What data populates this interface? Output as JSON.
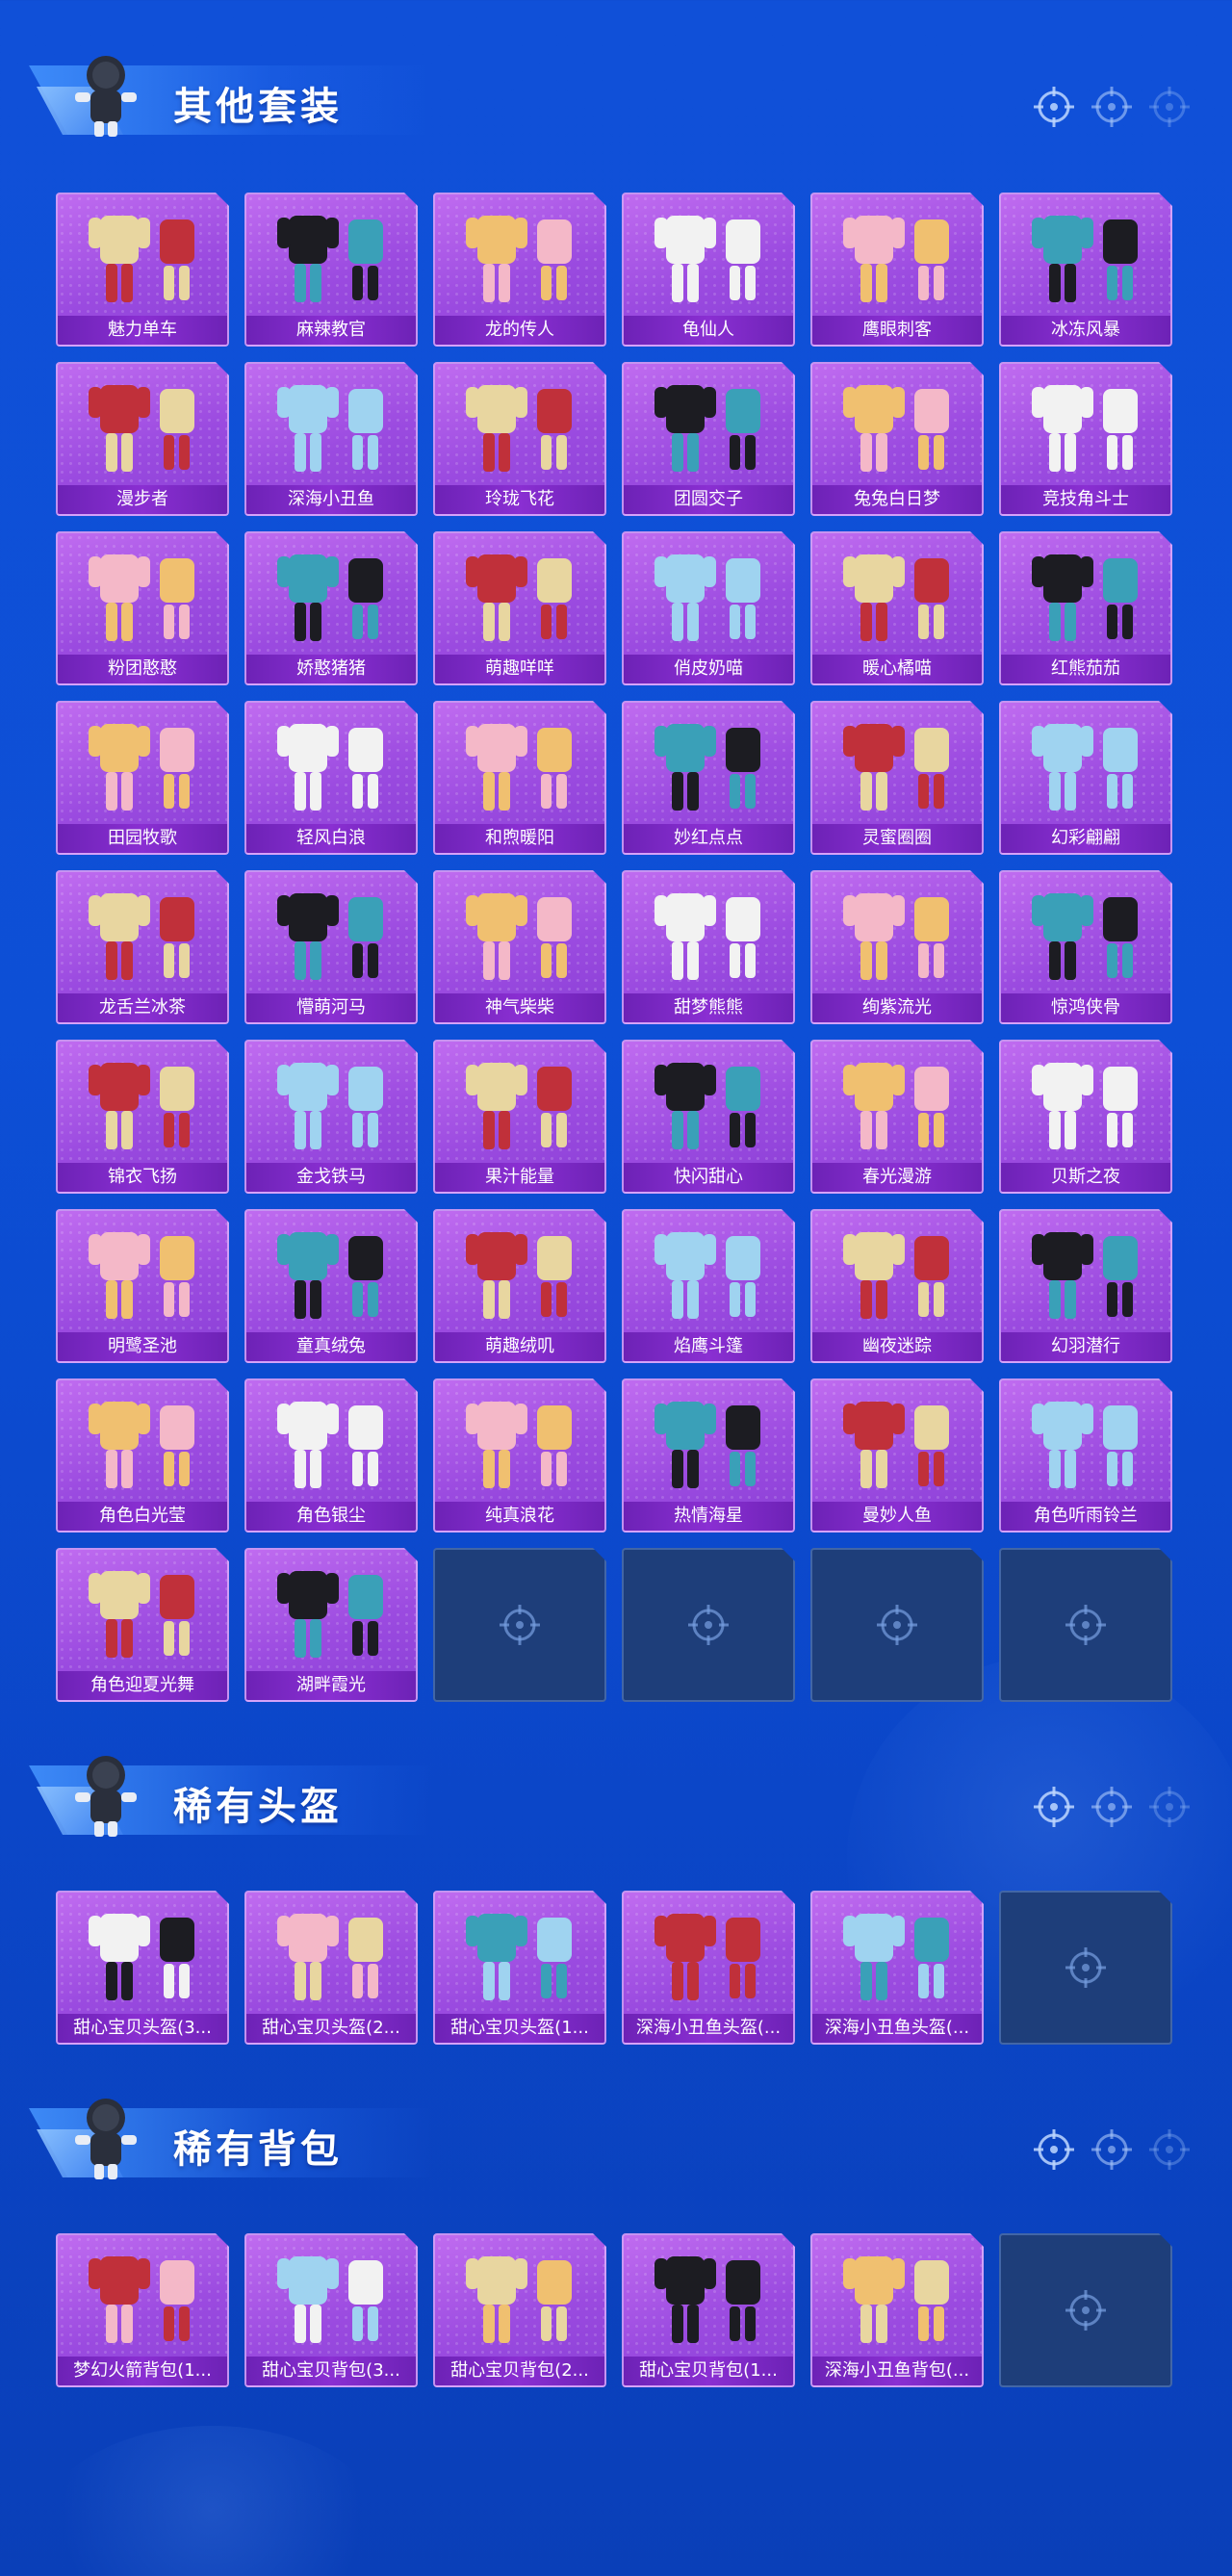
{
  "colors": {
    "page_bg": "#0d4fd6",
    "card_bg": "#a957e6",
    "card_label_bg": "#7a2bc4",
    "empty_card_bg": "#1e3e7a"
  },
  "sections": [
    {
      "title": "其他套装",
      "items": [
        "魅力单车",
        "麻辣教官",
        "龙的传人",
        "龟仙人",
        "鹰眼刺客",
        "冰冻风暴",
        "漫步者",
        "深海小丑鱼",
        "玲珑飞花",
        "团圆交子",
        "兔兔白日梦",
        "竞技角斗士",
        "粉团憨憨",
        "娇憨猪猪",
        "萌趣咩咩",
        "俏皮奶喵",
        "暖心橘喵",
        "红熊茄茄",
        "田园牧歌",
        "轻风白浪",
        "和煦暖阳",
        "妙红点点",
        "灵蜜圈圈",
        "幻彩翩翩",
        "龙舌兰冰茶",
        "懵萌河马",
        "神气柴柴",
        "甜梦熊熊",
        "绚紫流光",
        "惊鸿侠骨",
        "锦衣飞扬",
        "金戈铁马",
        "果汁能量",
        "快闪甜心",
        "春光漫游",
        "贝斯之夜",
        "明鹭圣池",
        "童真绒兔",
        "萌趣绒叽",
        "焰鹰斗篷",
        "幽夜迷踪",
        "幻羽潜行",
        "角色白光莹",
        "角色银尘",
        "纯真浪花",
        "热情海星",
        "曼妙人鱼",
        "角色听雨铃兰",
        "角色迎夏光舞",
        "湖畔霞光"
      ],
      "empty_slots": 4
    },
    {
      "title": "稀有头盔",
      "items": [
        "甜心宝贝头盔(3...",
        "甜心宝贝头盔(2...",
        "甜心宝贝头盔(1...",
        "深海小丑鱼头盔(...",
        "深海小丑鱼头盔(..."
      ],
      "empty_slots": 1
    },
    {
      "title": "稀有背包",
      "items": [
        "梦幻火箭背包(1...",
        "甜心宝贝背包(3...",
        "甜心宝贝背包(2...",
        "甜心宝贝背包(1...",
        "深海小丑鱼背包(..."
      ],
      "empty_slots": 1
    }
  ]
}
